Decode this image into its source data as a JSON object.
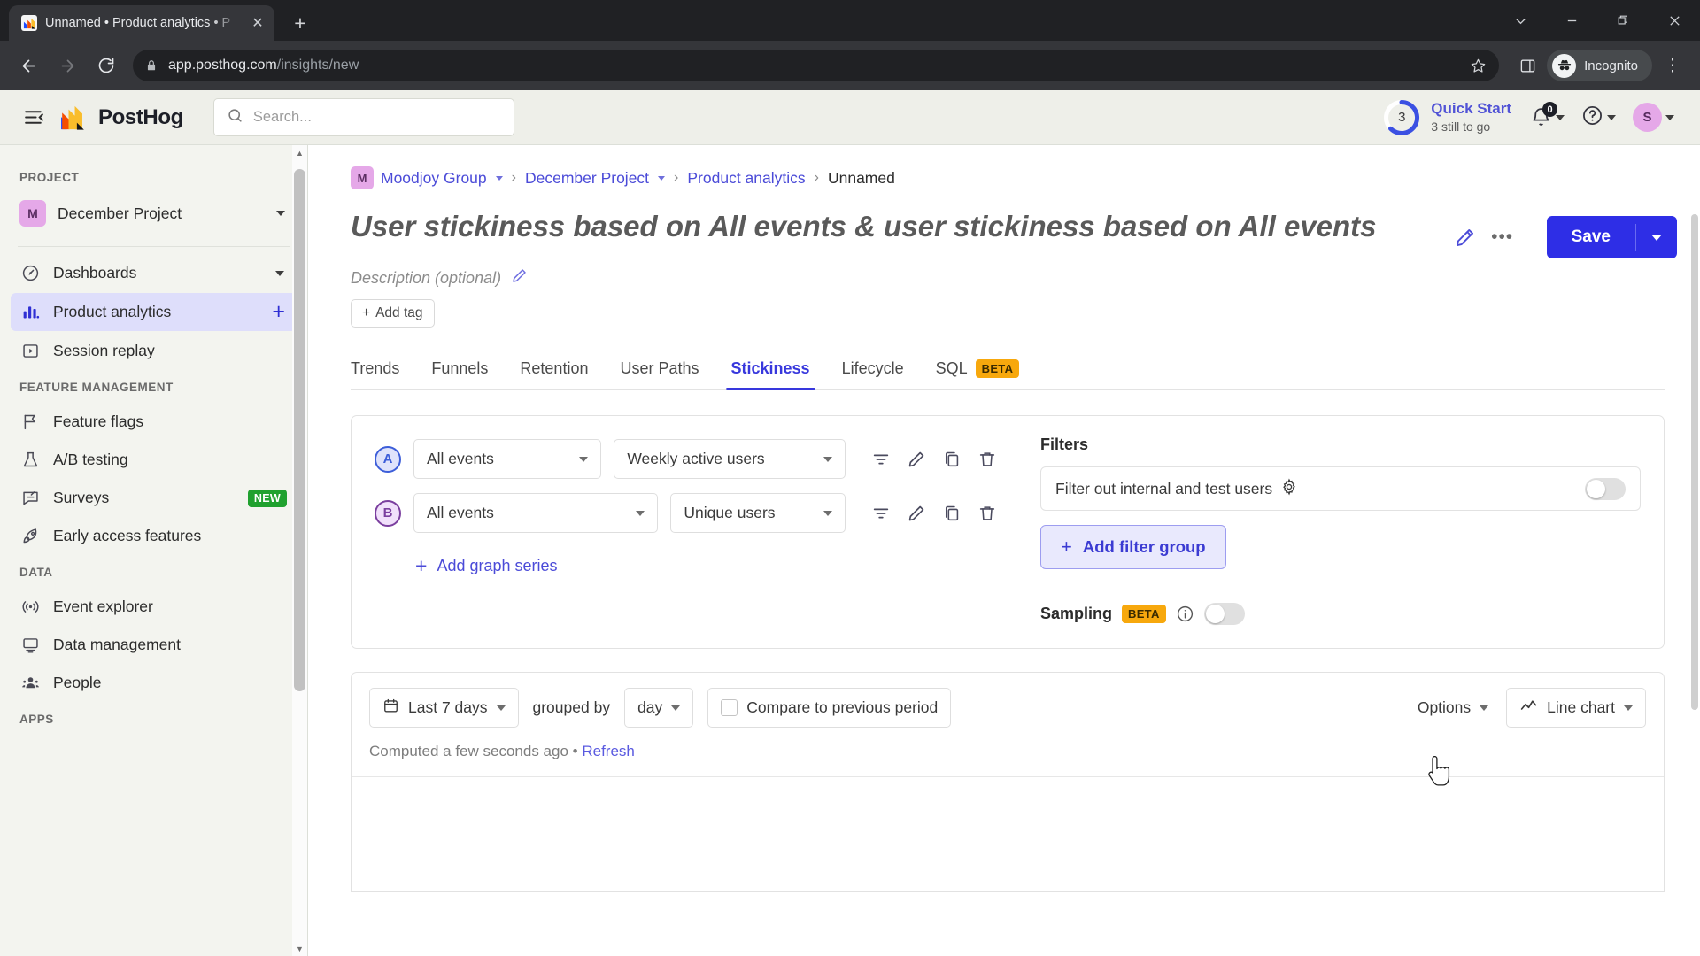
{
  "browser": {
    "tab_title": "Unnamed • Product analytics • P",
    "url_domain": "app.posthog.com",
    "url_path": "/insights/new",
    "profile_label": "Incognito",
    "new_tab_label": "+",
    "close_label": "✕"
  },
  "topbar": {
    "logo_text": "PostHog",
    "search_placeholder": "Search...",
    "quick_start_title": "Quick Start",
    "quick_start_sub": "3 still to go",
    "quick_start_count": "3",
    "notifications_count": "0",
    "avatar_initial": "S"
  },
  "sidebar": {
    "sections": [
      {
        "label": "PROJECT"
      },
      {
        "label": "FEATURE MANAGEMENT"
      },
      {
        "label": "DATA"
      },
      {
        "label": "APPS"
      }
    ],
    "project": {
      "badge": "M",
      "name": "December Project"
    },
    "items": [
      {
        "label": "Dashboards",
        "icon": "dashboard-icon",
        "active": false,
        "trailing": "caret"
      },
      {
        "label": "Product analytics",
        "icon": "bar-chart-icon",
        "active": true,
        "trailing": "plus"
      },
      {
        "label": "Session replay",
        "icon": "play-box-icon",
        "active": false,
        "trailing": ""
      },
      {
        "label": "Feature flags",
        "icon": "flag-icon",
        "active": false,
        "trailing": ""
      },
      {
        "label": "A/B testing",
        "icon": "flask-icon",
        "active": false,
        "trailing": ""
      },
      {
        "label": "Surveys",
        "icon": "survey-icon",
        "active": false,
        "trailing": "new"
      },
      {
        "label": "Early access features",
        "icon": "rocket-icon",
        "active": false,
        "trailing": ""
      },
      {
        "label": "Event explorer",
        "icon": "live-event-icon",
        "active": false,
        "trailing": ""
      },
      {
        "label": "Data management",
        "icon": "database-screen-icon",
        "active": false,
        "trailing": ""
      },
      {
        "label": "People",
        "icon": "people-icon",
        "active": false,
        "trailing": ""
      }
    ],
    "new_badge": "NEW"
  },
  "breadcrumb": {
    "org_badge": "M",
    "org": "Moodjoy Group",
    "project": "December Project",
    "section": "Product analytics",
    "current": "Unnamed",
    "separator": "›"
  },
  "insight": {
    "title": "User stickiness based on All events & user stickiness based on All events",
    "description_placeholder": "Description (optional)",
    "add_tag_label": "Add tag",
    "save_label": "Save"
  },
  "tabs": [
    {
      "label": "Trends",
      "active": false,
      "badge": ""
    },
    {
      "label": "Funnels",
      "active": false,
      "badge": ""
    },
    {
      "label": "Retention",
      "active": false,
      "badge": ""
    },
    {
      "label": "User Paths",
      "active": false,
      "badge": ""
    },
    {
      "label": "Stickiness",
      "active": true,
      "badge": ""
    },
    {
      "label": "Lifecycle",
      "active": false,
      "badge": ""
    },
    {
      "label": "SQL",
      "active": false,
      "badge": "BETA"
    }
  ],
  "series": [
    {
      "badge": "A",
      "event": "All events",
      "metric": "Weekly active users"
    },
    {
      "badge": "B",
      "event": "All events",
      "metric": "Unique users"
    }
  ],
  "add_graph_series_label": "Add graph series",
  "filters": {
    "title": "Filters",
    "internal_users_label": "Filter out internal and test users",
    "internal_users_on": false,
    "add_filter_group_label": "Add filter group",
    "sampling_label": "Sampling",
    "sampling_badge": "BETA",
    "sampling_on": false
  },
  "controls": {
    "date_range": "Last 7 days",
    "grouped_by_label": "grouped by",
    "interval": "day",
    "compare_label": "Compare to previous period",
    "compare_checked": false,
    "options_label": "Options",
    "chart_type": "Line chart",
    "computed_text": "Computed a few seconds ago",
    "computed_sep": "•",
    "refresh_label": "Refresh"
  },
  "colors": {
    "accent_blue": "#2e2ee6",
    "link_blue": "#4b4bd8",
    "series_a": "#3d5ed9",
    "series_b": "#7b3f9f",
    "beta_badge": "#f7a80d",
    "new_badge": "#20a12f",
    "avatar": "#e5a8e8"
  }
}
